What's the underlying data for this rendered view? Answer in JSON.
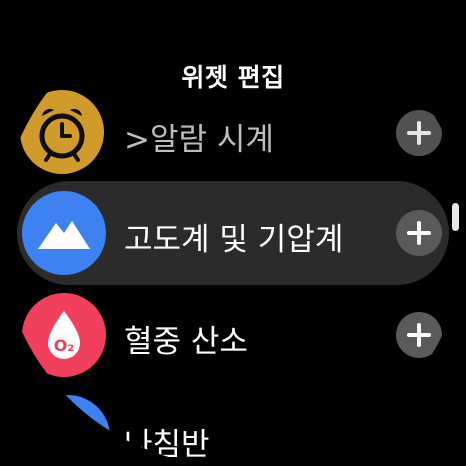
{
  "header": {
    "title": "위젯 편집"
  },
  "items": [
    {
      "label": ">알람 시계",
      "icon": "alarm-clock-icon",
      "color": "#f5b733"
    },
    {
      "label": "고도계 및 기압계",
      "icon": "mountain-icon",
      "color": "#3d82f0"
    },
    {
      "label": "혈중 산소",
      "icon": "blood-drop-o2-icon",
      "icon_text": "O₂",
      "color": "#f0405c"
    },
    {
      "label": "나침반",
      "icon": "compass-icon",
      "color": "#3d82f0"
    }
  ]
}
